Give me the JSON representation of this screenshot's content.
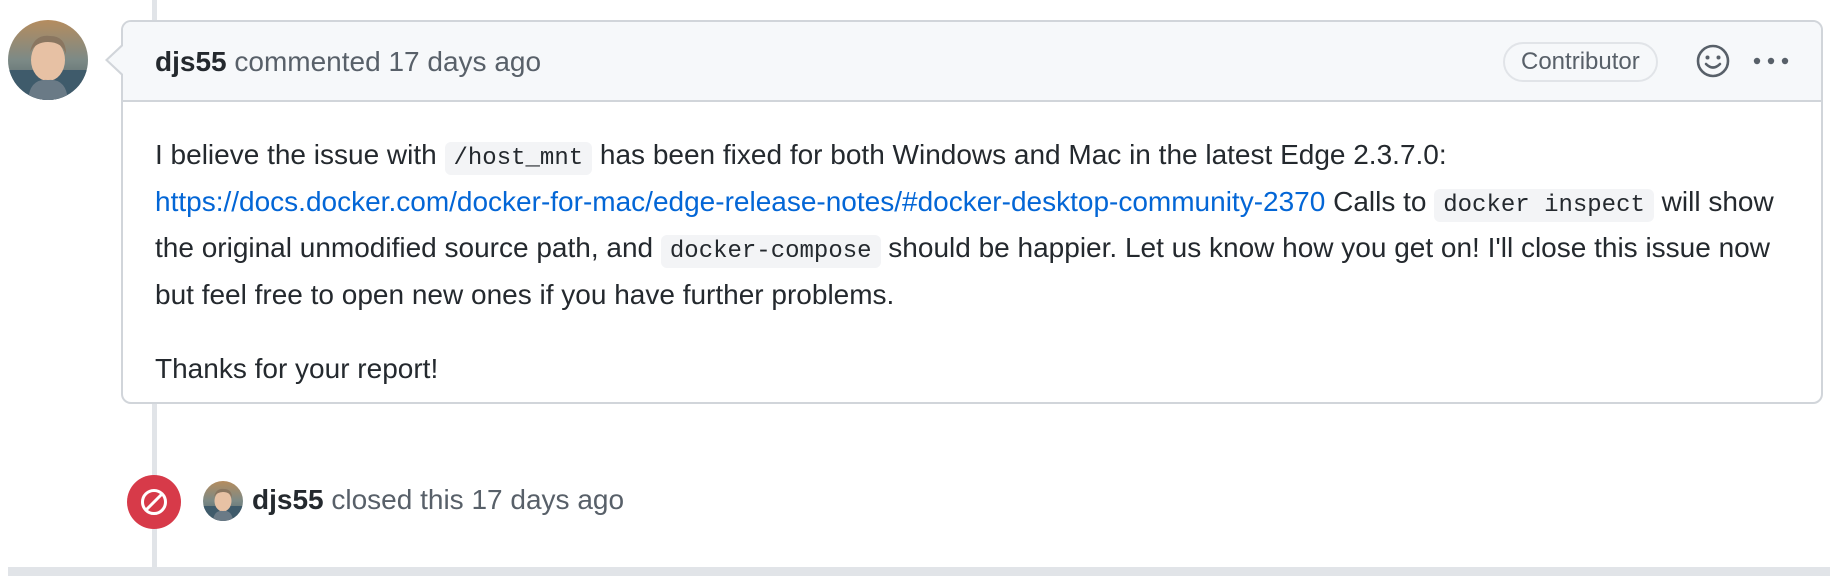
{
  "comment": {
    "author": "djs55",
    "action": "commented",
    "time": "17 days ago",
    "badge": "Contributor",
    "icons": {
      "reaction": "smiley-icon",
      "more": "kebab-horizontal-icon"
    },
    "body": {
      "p1_text_1": "I believe the issue with ",
      "p1_code_1": "/host_mnt",
      "p1_text_2": " has been fixed for both Windows and Mac in the latest Edge 2.3.7.0: ",
      "p1_link": "https://docs.docker.com/docker-for-mac/edge-release-notes/#docker-desktop-community-2370",
      "p1_text_3": " Calls to ",
      "p1_code_2": "docker inspect",
      "p1_text_4": " will show the original unmodified source path, and ",
      "p1_code_3": "docker-compose",
      "p1_text_5": " should be happier. Let us know how you get on! I'll close this issue now but feel free to open new ones if you have further problems.",
      "p2": "Thanks for your report!"
    }
  },
  "event": {
    "icon": "circle-slash-icon",
    "author": "djs55",
    "action": "closed this",
    "time": "17 days ago"
  },
  "colors": {
    "link": "#0366d6",
    "closed": "#d73a49",
    "border": "#d1d5da",
    "header_bg": "#f6f8fa"
  }
}
